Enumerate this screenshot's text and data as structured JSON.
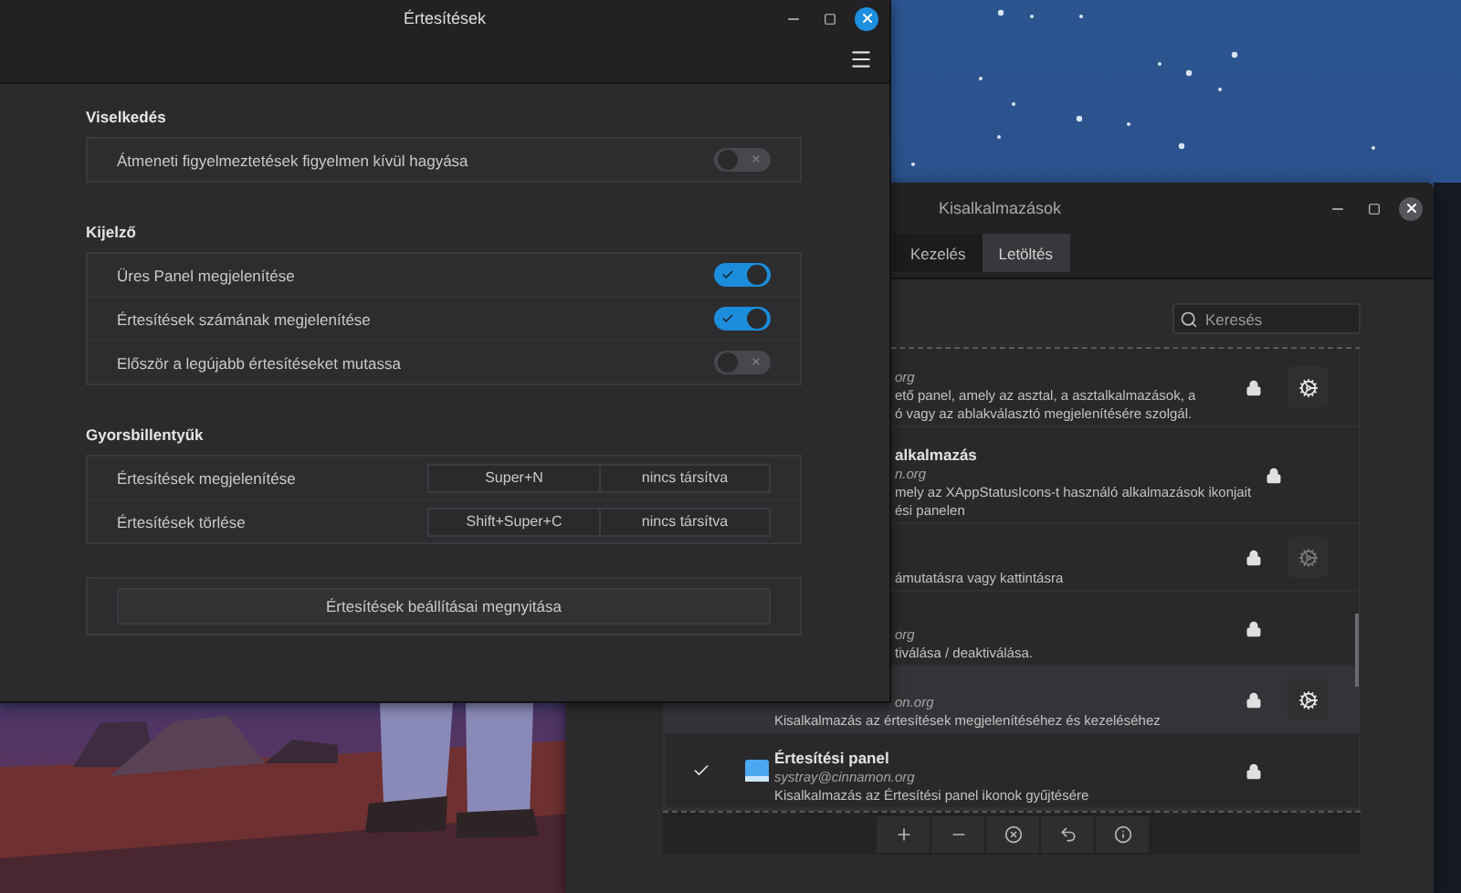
{
  "front_window": {
    "title": "Értesítések",
    "sections": [
      {
        "heading": "Viselkedés",
        "rows": [
          {
            "kind": "toggle",
            "label": "Átmeneti figyelmeztetések figyelmen kívül hagyása",
            "on": false
          }
        ]
      },
      {
        "heading": "Kijelző",
        "rows": [
          {
            "kind": "toggle",
            "label": "Üres Panel megjelenítése",
            "on": true
          },
          {
            "kind": "toggle",
            "label": "Értesítések számának megjelenítése",
            "on": true
          },
          {
            "kind": "toggle",
            "label": "Először a legújabb értesítéseket mutassa",
            "on": false
          }
        ]
      },
      {
        "heading": "Gyorsbillentyűk",
        "rows": [
          {
            "kind": "keybinding",
            "label": "Értesítések megjelenítése",
            "keys": [
              "Super+N",
              "nincs társítva"
            ]
          },
          {
            "kind": "keybinding",
            "label": "Értesítések törlése",
            "keys": [
              "Shift+Super+C",
              "nincs társítva"
            ]
          }
        ]
      },
      {
        "rows": [
          {
            "kind": "button",
            "label": "Értesítések beállításai megnyitása"
          }
        ]
      }
    ]
  },
  "back_window": {
    "title": "Kisalkalmazások",
    "tabs": [
      {
        "label": "Kezelés",
        "selected": false
      },
      {
        "label": "Letöltés",
        "selected": true
      }
    ],
    "search": {
      "placeholder": "Keresés"
    },
    "applets": [
      {
        "kind": "covered",
        "selected": false,
        "locked": true,
        "configure_button": {
          "disabled": false
        },
        "lines": [
          {
            "kind": "email",
            "text": "org",
            "cut": true
          },
          {
            "kind": "description",
            "text": "ető panel, amely az asztal, a asztalkalmazások, a",
            "cut": true
          },
          {
            "kind": "description",
            "text": "ó vagy az ablakválasztó megjelenítésére szolgál.",
            "cut": true
          }
        ]
      },
      {
        "kind": "covered",
        "selected": false,
        "locked": true,
        "lines": [
          {
            "kind": "name",
            "text": "alkalmazás",
            "cut": true
          },
          {
            "kind": "email",
            "text": "n.org",
            "cut": true
          },
          {
            "kind": "description",
            "text": "mely az XAppStatusIcons-t használó alkalmazások ikonjait",
            "cut": true
          },
          {
            "kind": "description",
            "text": "ési panelen",
            "cut": true
          }
        ]
      },
      {
        "kind": "covered",
        "selected": false,
        "locked": true,
        "configure_button": {
          "disabled": true
        },
        "lines": [
          {
            "kind": "description",
            "text": "ámutatásra vagy kattintásra",
            "cut": true
          }
        ]
      },
      {
        "kind": "covered",
        "selected": false,
        "locked": true,
        "lines": [
          {
            "kind": "email",
            "text": "org",
            "cut": true
          },
          {
            "kind": "description",
            "text": "tiválása / deaktiválása.",
            "cut": true
          }
        ]
      },
      {
        "kind": "covered",
        "selected": true,
        "locked": true,
        "configure_button": {
          "disabled": false
        },
        "lines": [
          {
            "kind": "email",
            "text": "on.org",
            "cut": true
          },
          {
            "kind": "description",
            "text": "Kisalkalmazás az értesítések megjelenítéséhez és kezeléséhez",
            "cut": false
          }
        ]
      },
      {
        "kind": "full",
        "selected": false,
        "checked": true,
        "locked": true,
        "lines": [
          {
            "kind": "name",
            "text": "Értesítési panel",
            "cut": false
          },
          {
            "kind": "email",
            "text": "systray@cinnamon.org",
            "cut": false
          },
          {
            "kind": "description",
            "text": "Kisalkalmazás az Értesítési panel ikonok gyűjtésére",
            "cut": false
          }
        ]
      }
    ],
    "toolbar": [
      {
        "kind": "add"
      },
      {
        "kind": "remove"
      },
      {
        "kind": "uninstall"
      },
      {
        "kind": "restore"
      },
      {
        "kind": "info"
      }
    ]
  }
}
